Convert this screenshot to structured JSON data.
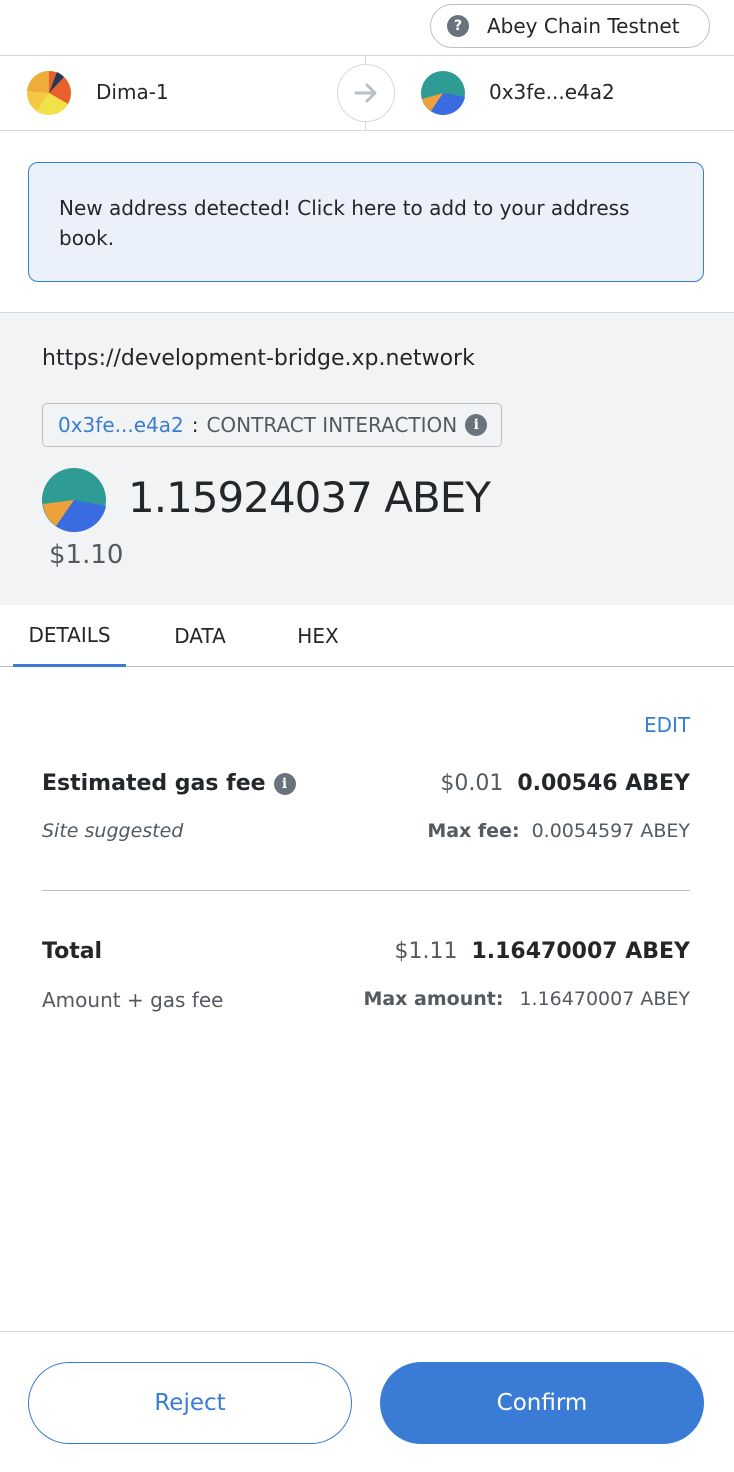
{
  "network": {
    "help_icon": "question-icon",
    "name": "Abey Chain Testnet"
  },
  "accounts": {
    "from_name": "Dima-1",
    "to_name": "0x3fe...e4a2",
    "arrow_icon": "arrow-right-icon"
  },
  "notice": {
    "text": "New address detected! Click here to add to your address book."
  },
  "summary": {
    "origin": "https://development-bridge.xp.network",
    "contract_address": "0x3fe...e4a2",
    "separator": ":",
    "interaction_label": "CONTRACT INTERACTION",
    "amount": "1.15924037 ABEY",
    "fiat": "$1.10"
  },
  "tabs": [
    {
      "label": "DETAILS",
      "active": true
    },
    {
      "label": "DATA",
      "active": false
    },
    {
      "label": "HEX",
      "active": false
    }
  ],
  "details": {
    "edit_label": "EDIT",
    "gas_label": "Estimated gas fee",
    "gas_fiat": "$0.01",
    "gas_amount": "0.00546 ABEY",
    "gas_sub": "Site suggested",
    "max_fee_label": "Max fee:",
    "max_fee_value": "0.0054597 ABEY",
    "total_label": "Total",
    "total_fiat": "$1.11",
    "total_amount": "1.16470007 ABEY",
    "total_sub": "Amount + gas fee",
    "max_amount_label": "Max amount:",
    "max_amount_value": "1.16470007 ABEY"
  },
  "footer": {
    "reject_label": "Reject",
    "confirm_label": "Confirm"
  },
  "colors": {
    "accent": "#3a7cd5",
    "notice_bg": "#eaf1fa",
    "summary_bg": "#f2f3f4"
  }
}
